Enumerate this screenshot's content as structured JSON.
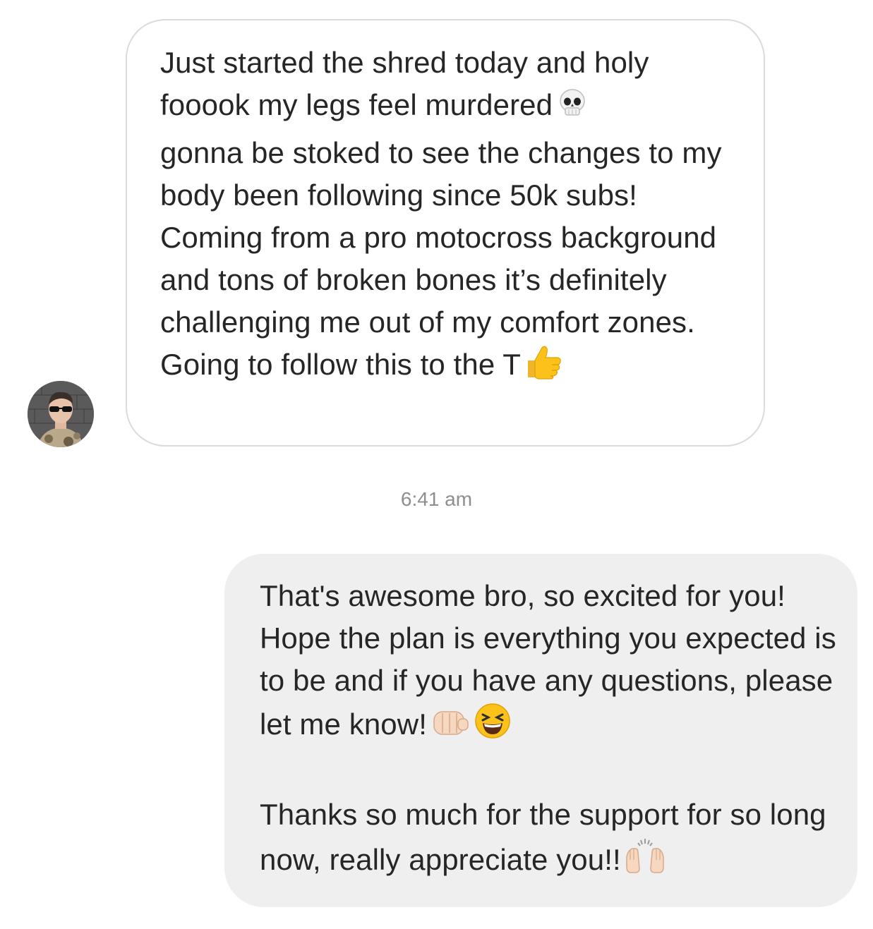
{
  "thread": {
    "incoming": {
      "text_before_skull": "Just started the shred today and holy fooook my legs feel murdered",
      "text_after_skull": "gonna be stoked to see the changes to my body been following since 50k subs! Coming from a pro motocross background and tons of broken bones it’s definitely challenging me out of my comfort zones. Going to follow this to the T",
      "emojis": [
        "skull-emoji",
        "thumbs-up-emoji"
      ]
    },
    "timestamp": "6:41 am",
    "outgoing": {
      "paragraph_1": "That's awesome bro, so excited for you! Hope the plan is everything you expected is to be and if you have any questions, please let me know!",
      "paragraph_2": "Thanks so much for the support for so long now, really appreciate you!!",
      "emojis": [
        "fist-bump-emoji",
        "grinning-squint-emoji",
        "raised-hands-emoji"
      ]
    }
  },
  "colors": {
    "incoming_border": "#dbdbdb",
    "outgoing_background": "#efefef",
    "text": "#262626",
    "timestamp": "#8e8e8e"
  }
}
